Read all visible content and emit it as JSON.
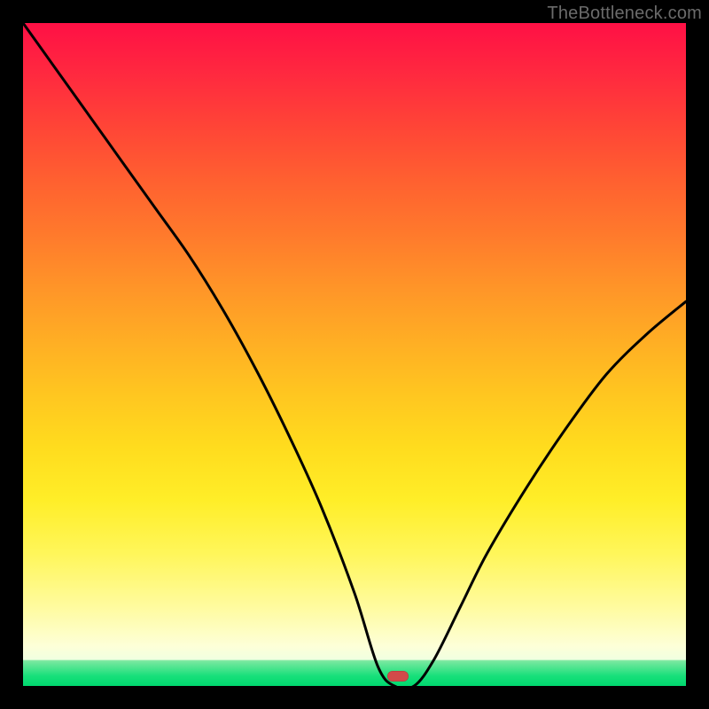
{
  "watermark": "TheBottleneck.com",
  "marker": {
    "x_frac": 0.565,
    "y_frac": 0.985
  },
  "chart_data": {
    "type": "line",
    "title": "",
    "xlabel": "",
    "ylabel": "",
    "xlim": [
      0,
      1
    ],
    "ylim": [
      0,
      1
    ],
    "grid": false,
    "legend": false,
    "note": "Axes have no visible tick labels; values are fractional positions read off the plot area.",
    "series": [
      {
        "name": "bottleneck-curve",
        "x": [
          0.0,
          0.05,
          0.1,
          0.15,
          0.2,
          0.25,
          0.3,
          0.35,
          0.4,
          0.45,
          0.5,
          0.535,
          0.56,
          0.59,
          0.62,
          0.66,
          0.7,
          0.76,
          0.82,
          0.88,
          0.94,
          1.0
        ],
        "y": [
          1.0,
          0.93,
          0.86,
          0.79,
          0.72,
          0.65,
          0.57,
          0.48,
          0.38,
          0.27,
          0.14,
          0.03,
          0.0,
          0.0,
          0.04,
          0.12,
          0.2,
          0.3,
          0.39,
          0.47,
          0.53,
          0.58
        ]
      }
    ],
    "minimum_marker": {
      "x": 0.565,
      "y": 0.0
    },
    "background_gradient": {
      "stops": [
        {
          "pos": 0.0,
          "color": "#ff1045"
        },
        {
          "pos": 0.5,
          "color": "#ffb722"
        },
        {
          "pos": 0.8,
          "color": "#fff65a"
        },
        {
          "pos": 0.94,
          "color": "#fdffd8"
        },
        {
          "pos": 0.97,
          "color": "#7be8a0"
        },
        {
          "pos": 1.0,
          "color": "#00d86f"
        }
      ]
    }
  }
}
